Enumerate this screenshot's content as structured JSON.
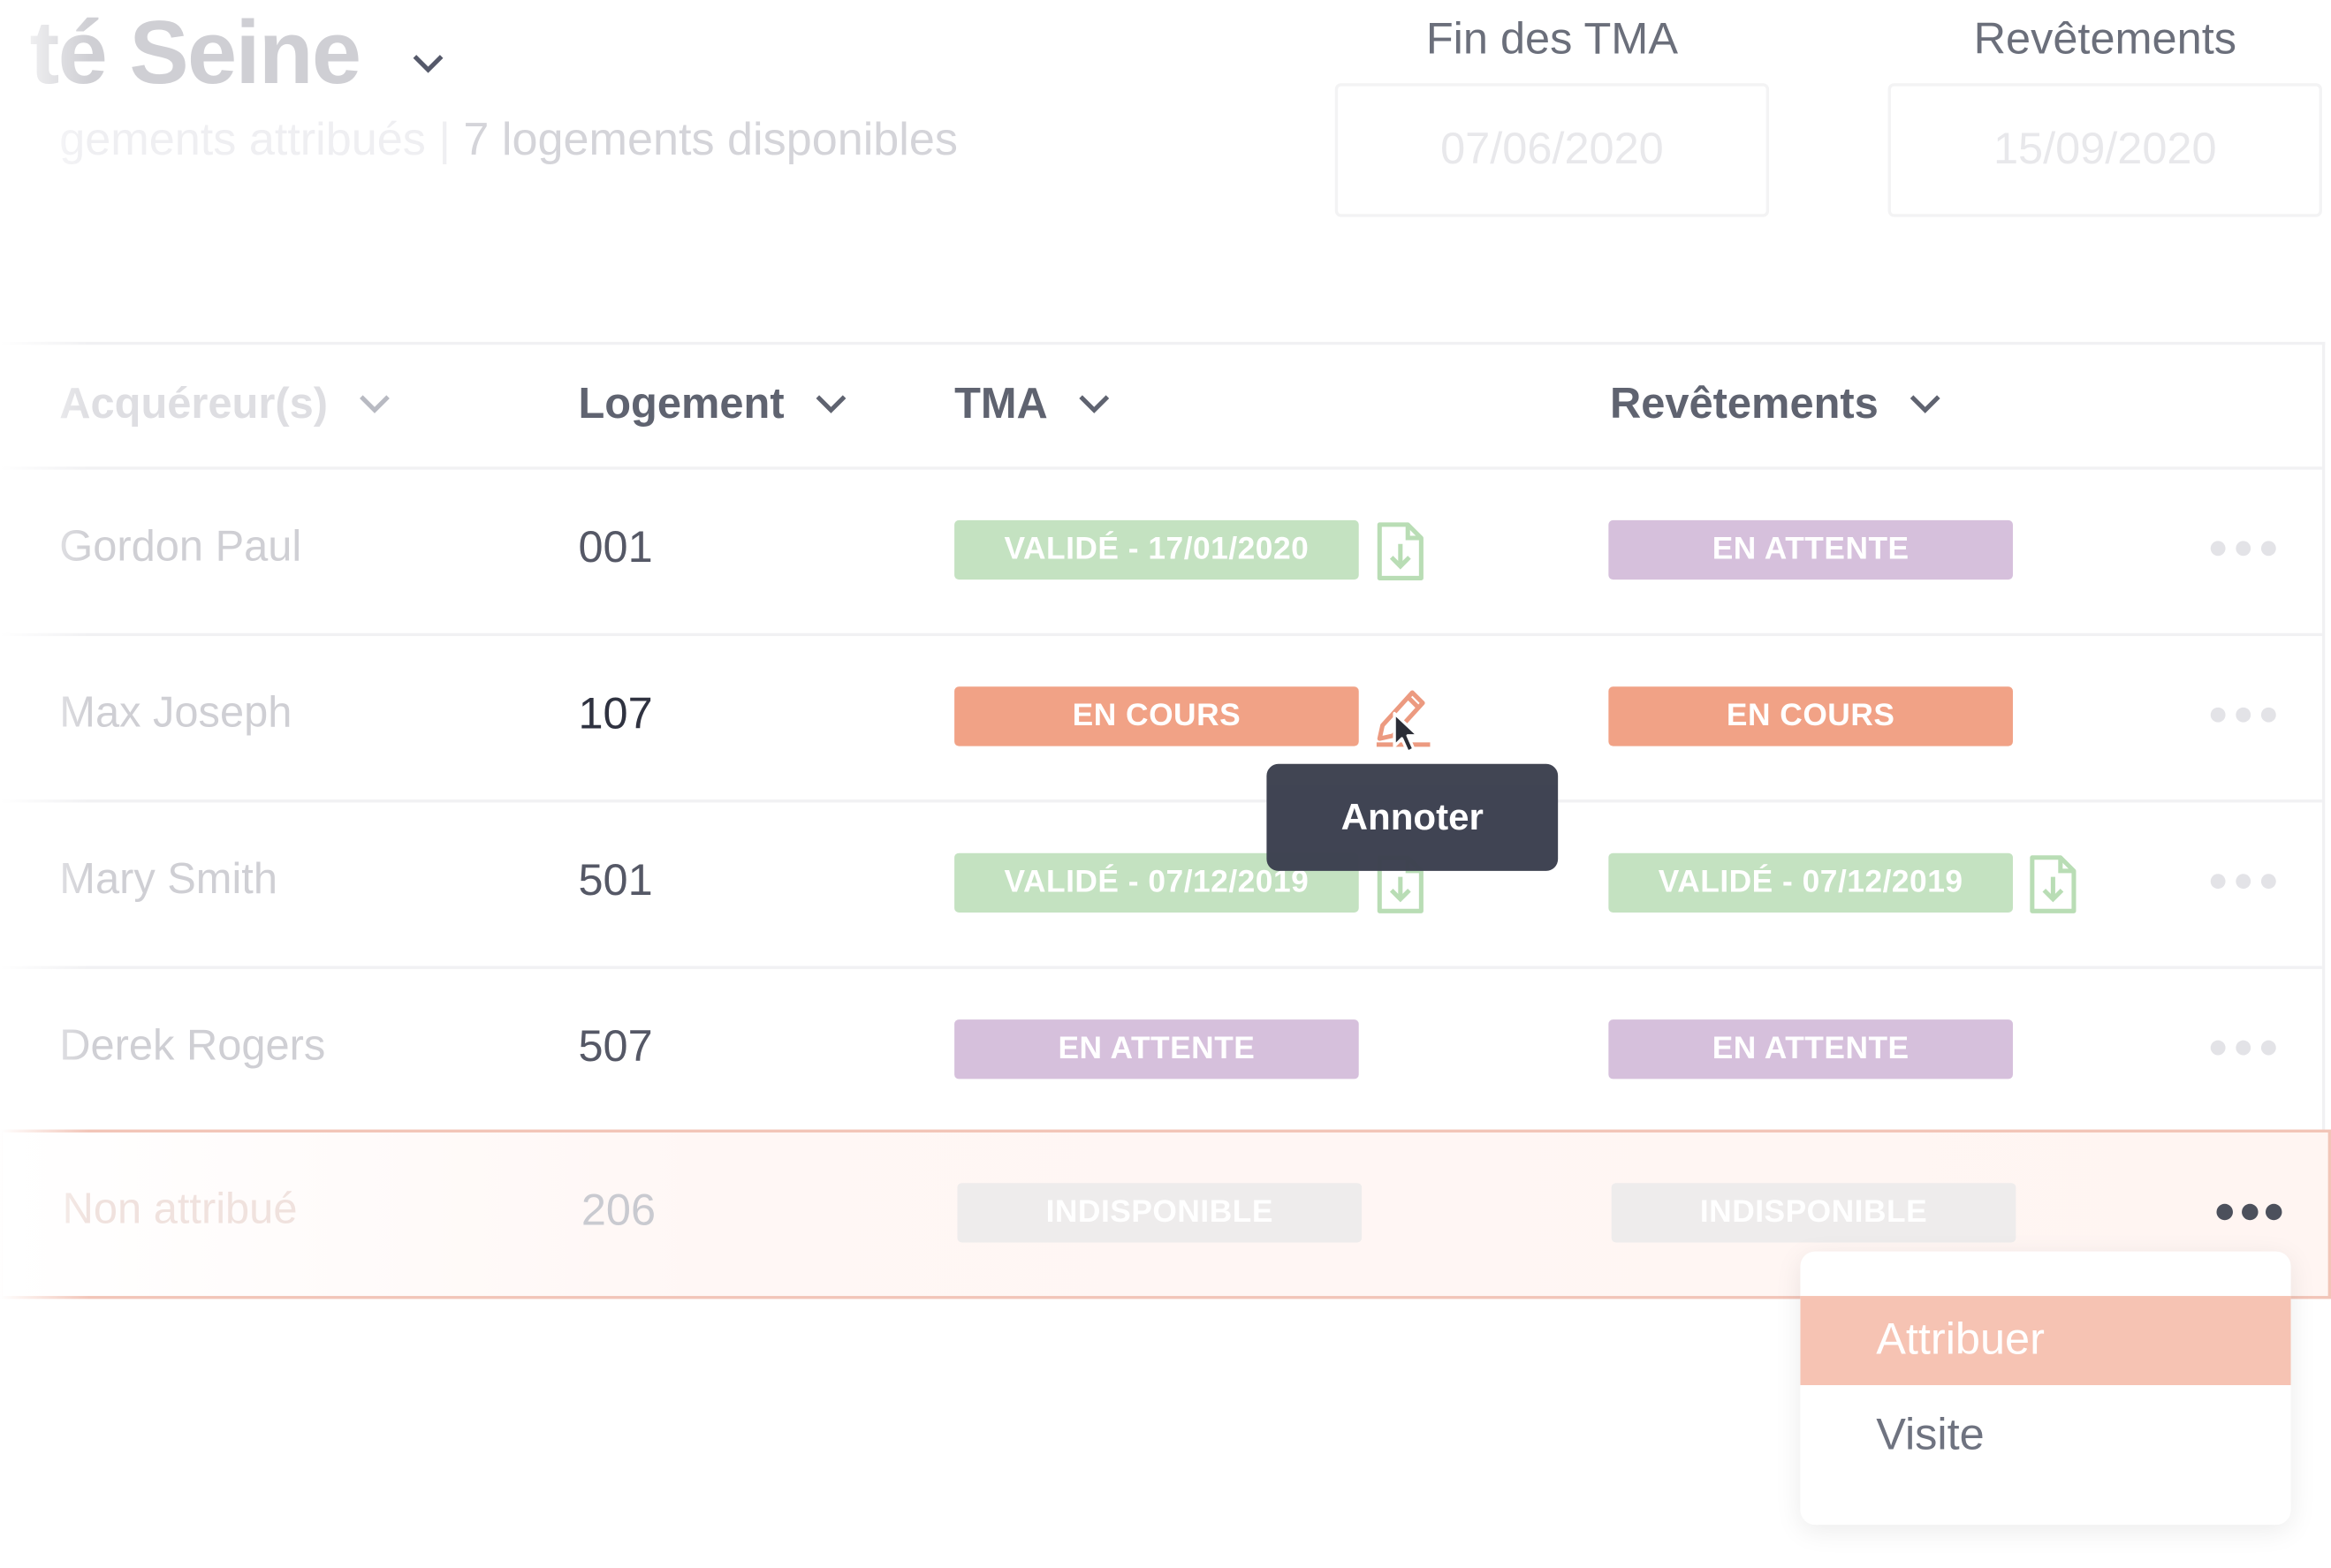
{
  "header": {
    "title": "té Seine",
    "subtitle_hidden": "gements attribués | ",
    "subtitle": "7 logements disponibles"
  },
  "dates": [
    {
      "label": "Fin des TMA",
      "value": "07/06/2020"
    },
    {
      "label": "Revêtements",
      "value": "15/09/2020"
    }
  ],
  "table": {
    "columns": [
      "Acquéreur(s)",
      "Logement",
      "TMA",
      "Revêtements"
    ],
    "rows": [
      {
        "name": "Gordon Paul",
        "lot": "001",
        "tma": "VALIDÉ - 17/01/2020",
        "rev": "EN ATTENTE"
      },
      {
        "name": "Max Joseph",
        "lot": "107",
        "tma": "EN COURS",
        "rev": "EN COURS"
      },
      {
        "name": "Mary Smith",
        "lot": "501",
        "tma": "VALIDÉ - 07/12/2019",
        "rev": "VALIDÉ - 07/12/2019"
      },
      {
        "name": "Derek Rogers",
        "lot": "507",
        "tma": "EN ATTENTE",
        "rev": "EN ATTENTE"
      },
      {
        "name": "Non attribué",
        "lot": "206",
        "tma": "INDISPONIBLE",
        "rev": "INDISPONIBLE"
      }
    ]
  },
  "tooltip": "Annoter",
  "menu": [
    "Attribuer",
    "Visite"
  ],
  "colors": {
    "valid": "#c4e2c1",
    "in_progress": "#f1a286",
    "waiting": "#d6c0dc",
    "unavailable": "#eeecec",
    "menu_active": "#f6c3b3",
    "tooltip": "#3d4150"
  }
}
